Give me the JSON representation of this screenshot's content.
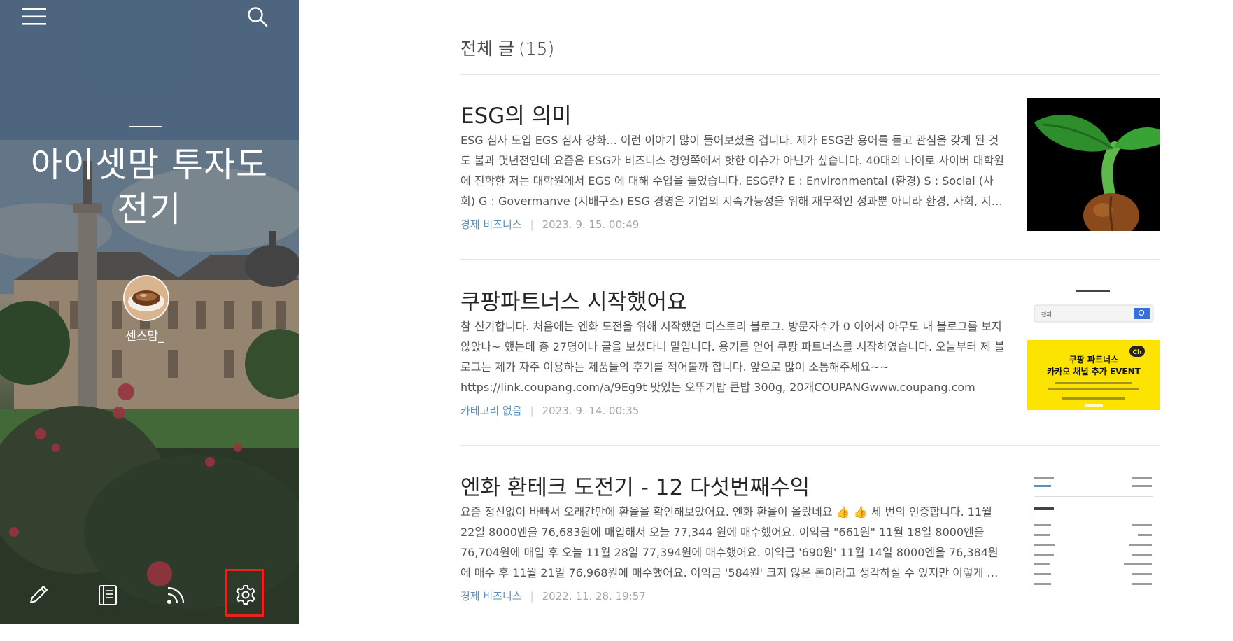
{
  "blog": {
    "title": "아이셋맘 투자도 전기",
    "author": "센스맘_"
  },
  "sidebar": {
    "menu_icon": "hamburger-menu-icon",
    "search_icon": "search-icon",
    "bottom_icons": [
      "pencil-icon",
      "notebook-icon",
      "rss-icon",
      "gear-icon"
    ],
    "highlight_color": "#e8231e"
  },
  "list": {
    "heading": "전체 글",
    "count": "(15)"
  },
  "posts": [
    {
      "title": "ESG의 의미",
      "excerpt": "ESG 심사 도입 EGS 심사 강화... 이런 이야기 많이 들어보셨을 겁니다. 제가 ESG란 용어를 듣고 관심을 갖게 된 것도 불과 몇년전인데 요즘은 ESG가 비즈니스 경영쪽에서 핫한 이슈가 아닌가 싶습니다. 40대의 나이로 사이버 대학원에 진학한 저는 대학원에서 EGS 에 대해 수업을 들었습니다. ESG란? E : Environmental (환경) S : Social (사회) G : Govermanve (지배구조) ESG 경영은 기업의 지속가능성을 위해 재무적인 성과뿐 아니라 환경, 사회, 지배구조 성과와 요소를 고려하는 경영입니다.",
      "category": "경제 비즈니스",
      "date": "2023. 9. 15. 00:49"
    },
    {
      "title": "쿠팡파트너스 시작했어요",
      "excerpt": "참 신기합니다. 처음에는 엔화 도전을 위해 시작했던 티스토리 블로그. 방문자수가 0 이어서 아무도 내 블로그를 보지 않았나~ 했는데 총 27명이나 글을 보셨다니 말입니다. 용기를 얻어 쿠팡 파트너스를 시작하였습니다. 오늘부터 제 블로그는 제가 자주 이용하는 제품들의 후기를 적어볼까 합니다. 앞으로 많이 소통해주세요~~ https://link.coupang.com/a/9Eg9t 맛있는 오뚜기밥 큰밥 300g, 20개COUPANGwww.coupang.com",
      "category": "카테고리 없음",
      "date": "2023. 9. 14. 00:35",
      "thumb": {
        "search_label": "전체",
        "banner_line1": "쿠팡 파트너스",
        "banner_line2": "카카오 채널 추가 EVENT",
        "badge": "Ch"
      }
    },
    {
      "title": "엔화 환테크 도전기 - 12 다섯번째수익",
      "excerpt": "요즘 정신없이 바빠서 오래간만에 환율을 확인해보았어요. 엔화 환율이 올랐네요 👍 👍 세 번의 인증합니다. 11월 22일 8000엔을 76,683원에 매입해서 오늘 77,344 원에 매수했어요. 이익금 \"661원\" 11월 18일 8000엔을 76,704원에 매입 후 오늘 11월 28일 77,394원에 매수했어요. 이익금 '690원' 11월 14일 8000엔을 76,384원에 매수 후 11월 21일 76,968원에 매수했어요. 이익금 '584원' 크지 않은 돈이라고 생각하실 수 있지만 이렇게 환전으로 통장에 조금씩 쌓이는 것이 재미있습니다.",
      "category": "경제 비즈니스",
      "date": "2022. 11. 28. 19:57"
    }
  ]
}
